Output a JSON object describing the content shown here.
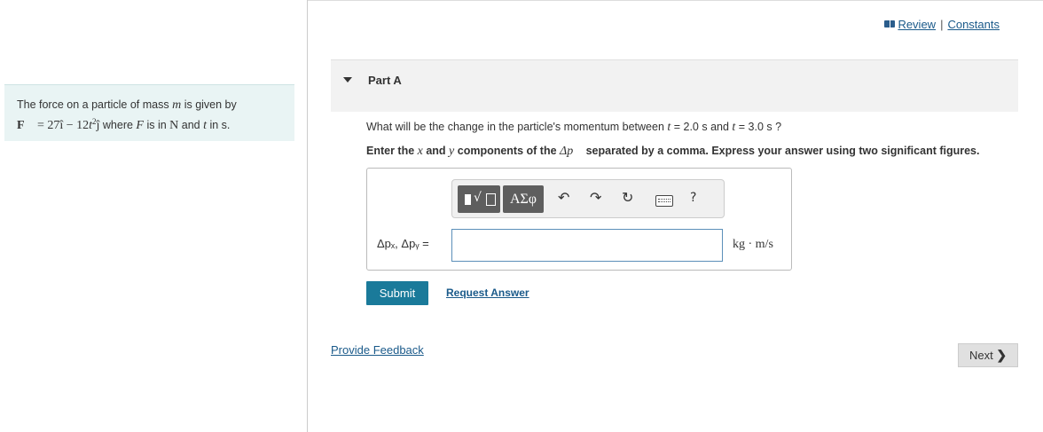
{
  "problem": {
    "line1_prefix": "The force on a particle of mass ",
    "line1_var": "m",
    "line1_suffix": " is given by",
    "force_vec": "F⃗",
    "force_eq": " = 27î − 12",
    "force_t": "t",
    "force_exp": "2",
    "force_j": "ĵ",
    "where": " where ",
    "F": "F",
    "is_in": " is in ",
    "N": "N",
    "and": " and ",
    "t": "t",
    "in_s": " in s."
  },
  "header_links": {
    "review": "Review",
    "separator": "|",
    "constants": "Constants"
  },
  "part": {
    "title": "Part A"
  },
  "question": {
    "prefix": "What will be the change in the particle's momentum between ",
    "t1_var": "t",
    "t1_val": " = 2.0 s and ",
    "t2_var": "t",
    "t2_val": " = 3.0 s ?"
  },
  "instruction": {
    "p1": "Enter the ",
    "x": "x",
    "p2": " and ",
    "y": "y",
    "p3": " components of the ",
    "delta_p": "Δp⃗",
    "p4": " separated by a comma. Express your answer using two significant figures."
  },
  "toolbar": {
    "greek": "ΑΣφ",
    "radical": "√",
    "undo": "↶",
    "redo": "↷",
    "reset": "↻",
    "help": "?"
  },
  "answer": {
    "label": "Δpₓ, Δpᵧ =",
    "value": "",
    "units": "kg · m/s"
  },
  "buttons": {
    "submit": "Submit",
    "request_answer": "Request Answer",
    "provide_feedback": "Provide Feedback",
    "next": "Next",
    "next_chevron": "❯"
  }
}
